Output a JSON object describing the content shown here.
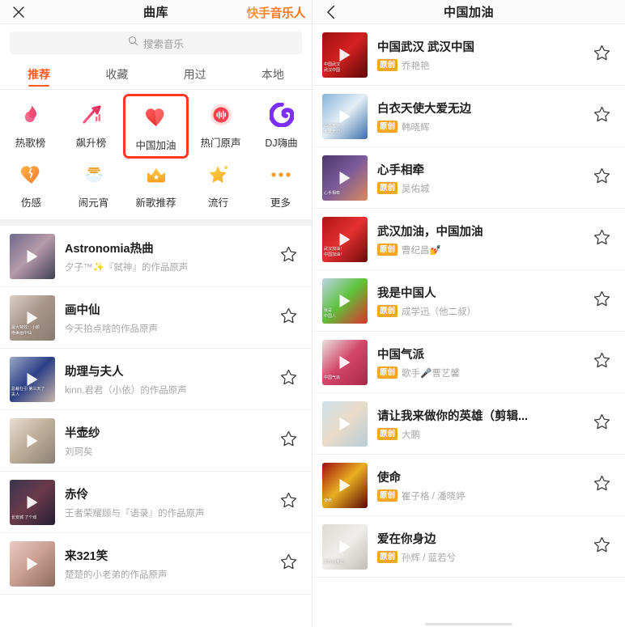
{
  "left_panel": {
    "navbar": {
      "close_icon": "close-icon",
      "title": "曲库",
      "brand": "快手音乐人"
    },
    "search": {
      "icon": "search-icon",
      "placeholder": "搜索音乐",
      "value": ""
    },
    "tabs": [
      {
        "label": "推荐",
        "active": true
      },
      {
        "label": "收藏",
        "active": false
      },
      {
        "label": "用过",
        "active": false
      },
      {
        "label": "本地",
        "active": false
      }
    ],
    "categories": [
      {
        "label": "热歌榜",
        "icon": "flame-icon",
        "highlighted": false
      },
      {
        "label": "飙升榜",
        "icon": "rising-arrow-icon",
        "highlighted": false
      },
      {
        "label": "中国加油",
        "icon": "heart-icon",
        "highlighted": true
      },
      {
        "label": "热门原声",
        "icon": "waveform-icon",
        "highlighted": false
      },
      {
        "label": "DJ嗨曲",
        "icon": "disc-icon",
        "highlighted": false
      },
      {
        "label": "伤感",
        "icon": "broken-heart-icon",
        "highlighted": false
      },
      {
        "label": "闹元宵",
        "icon": "lantern-bowl-icon",
        "highlighted": false
      },
      {
        "label": "新歌推荐",
        "icon": "crown-icon",
        "highlighted": false
      },
      {
        "label": "流行",
        "icon": "star-icon",
        "highlighted": false
      },
      {
        "label": "更多",
        "icon": "more-dots-icon",
        "highlighted": false
      }
    ],
    "songs": [
      {
        "title": "Astronomia热曲",
        "original": false,
        "artist": "夕子™✨『弑神』的作品原声",
        "fav_icon": "star-outline-icon",
        "thumb_colors": [
          "#6e6a8c",
          "#b79aa8",
          "#3d3f55"
        ],
        "thumb_overlay": ""
      },
      {
        "title": "画中仙",
        "original": false,
        "artist": "今天拍点啥的作品原声",
        "fav_icon": "star-outline-icon",
        "thumb_colors": [
          "#d9cfc6",
          "#a89489",
          "#8c7a70"
        ],
        "thumb_overlay": "最大特效：小颜\n绝美画中仙"
      },
      {
        "title": "助理与夫人",
        "original": false,
        "artist": "kinn.君君（小依）的作品原声",
        "fav_icon": "star-outline-icon",
        "thumb_colors": [
          "#9aa6c4",
          "#2c3f87",
          "#c8b7a6"
        ],
        "thumb_overlay": "总裁在引  第三天了\n夫人"
      },
      {
        "title": "半壶纱",
        "original": false,
        "artist": "刘珂矣",
        "fav_icon": "star-outline-icon",
        "thumb_colors": [
          "#e6ddd2",
          "#bfae99",
          "#8c8173"
        ],
        "thumb_overlay": ""
      },
      {
        "title": "赤伶",
        "original": false,
        "artist": "王者荣耀顾与『语录』的作品原声",
        "fav_icon": "star-outline-icon",
        "thumb_colors": [
          "#3a3550",
          "#6b3a4a",
          "#241f33"
        ],
        "thumb_overlay": "长安城  了个戏"
      },
      {
        "title": "来321笑",
        "original": false,
        "artist": "楚楚的小老弟的作品原声",
        "fav_icon": "star-outline-icon",
        "thumb_colors": [
          "#e9c9c2",
          "#caa093",
          "#8d6b5e"
        ],
        "thumb_overlay": ""
      }
    ]
  },
  "right_panel": {
    "navbar": {
      "back_icon": "chevron-left-icon",
      "title": "中国加油"
    },
    "songs": [
      {
        "title": "中国武汉 武汉中国",
        "original": true,
        "badge": "原创",
        "artist": "乔艳艳",
        "fav_icon": "star-outline-icon",
        "thumb_colors": [
          "#9e1010",
          "#d42020",
          "#5c0808"
        ],
        "thumb_overlay": "中国武汉\n武汉中国"
      },
      {
        "title": "白衣天使大爱无边",
        "original": true,
        "badge": "原创",
        "artist": "韩晓辉",
        "fav_icon": "star-outline-icon",
        "thumb_colors": [
          "#88b4d8",
          "#e4eef6",
          "#3a6fa8"
        ],
        "thumb_overlay": "白衣天使\n大爱无边"
      },
      {
        "title": "心手相牵",
        "original": true,
        "badge": "原创",
        "artist": "吴佑城",
        "fav_icon": "star-outline-icon",
        "thumb_colors": [
          "#4a3768",
          "#7c5a9c",
          "#d98a5a"
        ],
        "thumb_overlay": "心手相牵"
      },
      {
        "title": "武汉加油，中国加油",
        "original": true,
        "badge": "原创",
        "artist": "曹纪昌💅",
        "fav_icon": "star-outline-icon",
        "thumb_colors": [
          "#b01414",
          "#e63030",
          "#6e0a0a"
        ],
        "thumb_overlay": "武汉加油！\n中国加油！"
      },
      {
        "title": "我是中国人",
        "original": true,
        "badge": "原创",
        "artist": "成学迅（他二叔）",
        "fav_icon": "star-outline-icon",
        "thumb_colors": [
          "#bcd4e8",
          "#5ec23a",
          "#e03030"
        ],
        "thumb_overlay": "我是\n中国人"
      },
      {
        "title": "中国气派",
        "original": true,
        "badge": "原创",
        "artist": "歌手🎤曹艺馨",
        "fav_icon": "star-outline-icon",
        "thumb_colors": [
          "#e8e2dc",
          "#d4466a",
          "#a82848"
        ],
        "thumb_overlay": "中国气派"
      },
      {
        "title": "请让我来做你的英雄（剪辑...",
        "original": true,
        "badge": "原创",
        "artist": "大鹏",
        "fav_icon": "star-outline-icon",
        "thumb_colors": [
          "#cfe0ea",
          "#e8dcc8",
          "#b9cdd8"
        ],
        "thumb_overlay": ""
      },
      {
        "title": "使命",
        "original": true,
        "badge": "原创",
        "artist": "崔子格 / 潘晓婷",
        "fav_icon": "star-outline-icon",
        "thumb_colors": [
          "#a01010",
          "#e8b020",
          "#5c0606"
        ],
        "thumb_overlay": "使命"
      },
      {
        "title": "爱在你身边",
        "original": true,
        "badge": "原创",
        "artist": "孙辉 / 蓝若兮",
        "fav_icon": "star-outline-icon",
        "thumb_colors": [
          "#ddd9d4",
          "#f0eeea",
          "#c2bdb6"
        ],
        "thumb_overlay": "爱在你身边"
      }
    ]
  },
  "colors": {
    "accent_orange": "#ff5a1f",
    "highlight_red": "#fb3b21",
    "badge_orange": "#f5a623",
    "nav_bg": "#fbfbfb",
    "divider": "#f0f0f0",
    "subtext": "#a8a8a8"
  }
}
